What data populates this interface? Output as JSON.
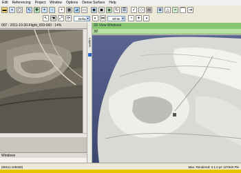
{
  "menu": {
    "items": [
      "Edit",
      "Referencing",
      "Project",
      "Window",
      "Options",
      "Dense Surface",
      "Help"
    ]
  },
  "toolbar": {
    "combo_default": "Default",
    "combo_white": "White"
  },
  "left_panel": {
    "header": "007 - 2011-10-30-Flight_003-060 : 14%",
    "lower_header": "Windows"
  },
  "side_tab": {
    "label": "Layers"
  },
  "view": {
    "title": "3D View Windows",
    "subtitle": "3D"
  },
  "status": {
    "coords": "(89111.106328)",
    "info": "Max. Rendered: 2.1.0 pt: 127640 Ple",
    "progress_fraction": 1.0,
    "progress_color": "#e6c400"
  },
  "colors": {
    "view_title_bg": "#88c770",
    "view_canvas_bg": "#4c5880"
  }
}
